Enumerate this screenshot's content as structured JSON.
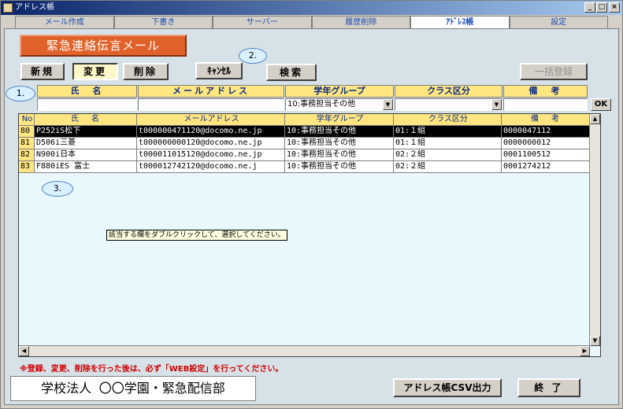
{
  "window": {
    "title": "アドレス帳"
  },
  "tabs": [
    {
      "label": "メール作成"
    },
    {
      "label": "下書き"
    },
    {
      "label": "サーバー"
    },
    {
      "label": "履歴削除"
    },
    {
      "label": "ｱﾄﾞﾚｽ帳",
      "active": true
    },
    {
      "label": "設定"
    }
  ],
  "banner": "緊急連絡伝言メール",
  "toolbar": {
    "new": "新規",
    "edit": "変更",
    "delete": "削除",
    "cancel": "ｷｬﾝｾﾙ",
    "search": "検索",
    "bulk_register": "一括登録"
  },
  "callouts": {
    "c1": "1.",
    "c2": "2.",
    "c3": "3."
  },
  "filter": {
    "headers": [
      "氏　名",
      "メールアドレス",
      "学年グループ",
      "クラス区分",
      "備　考"
    ],
    "grade_group_value": "10:事務担当その他",
    "class_value": "",
    "ok": "OK"
  },
  "grid": {
    "columns": [
      "No",
      "氏　名",
      "メールアドレス",
      "学年グループ",
      "クラス区分",
      "備　考"
    ],
    "rows": [
      {
        "no": "80",
        "name": "P252iS松下",
        "email": "t000000471120@docomo.ne.jp",
        "group": "10:事務担当その他",
        "class": "01:１組",
        "note": "0000047112"
      },
      {
        "no": "81",
        "name": "D506i三菱",
        "email": "t000000000120@docomo.ne.jp",
        "group": "10:事務担当その他",
        "class": "01:１組",
        "note": "0000000012"
      },
      {
        "no": "82",
        "name": "N900i日本",
        "email": "t000011015120@docomo.ne.jp",
        "group": "10:事務担当その他",
        "class": "02:２組",
        "note": "0001100512"
      },
      {
        "no": "83",
        "name": "F880iES 富士",
        "email": "t000012742120@docomo.ne.j",
        "group": "10:事務担当その他",
        "class": "02:２組",
        "note": "0001274212"
      }
    ]
  },
  "tooltip": "該当する欄をダブルクリックして、選択してください。",
  "warning": "※登録、変更、削除を行った後は、必ず「WEB設定」を行ってください。",
  "footer": {
    "org": "学校法人 〇〇学園・緊急配信部",
    "csv_export": "アドレス帳CSV出力",
    "exit": "終 了"
  },
  "colors": {
    "banner": "#e0622a",
    "header": "#ffe680",
    "tab_text": "#1a4db3",
    "warning": "#d00000"
  }
}
